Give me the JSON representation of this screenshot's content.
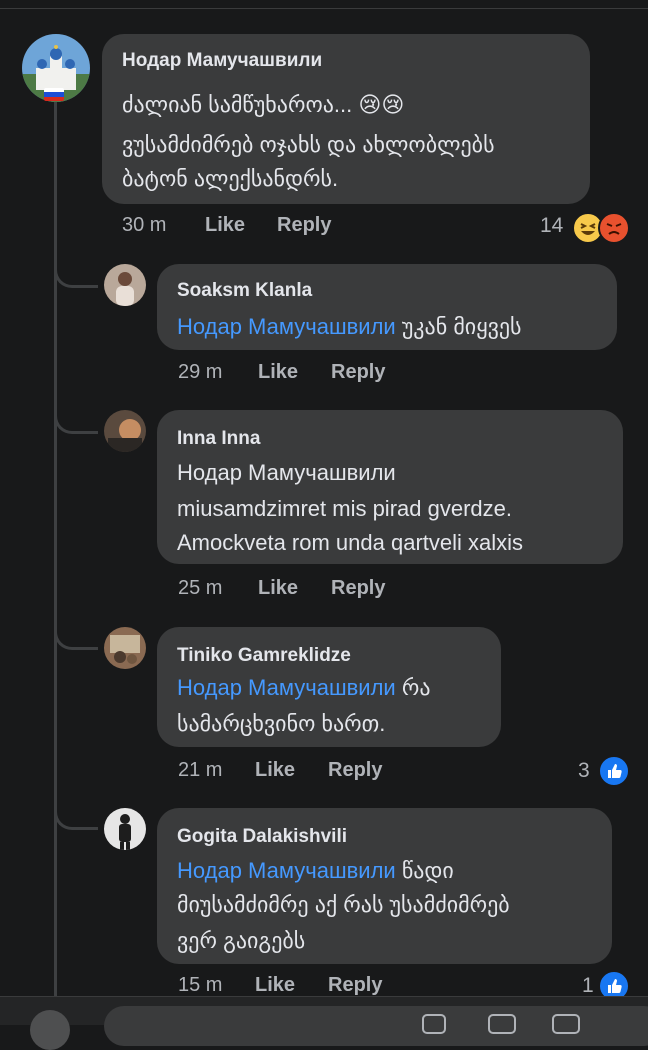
{
  "comments": [
    {
      "name": "Нодар Мамучашвили",
      "mention": "",
      "lines": [
        "ძალიან სამწუხაროა... 😢😢",
        "ვუსამძიმრებ ოჯახს და ახლობლებს",
        "ბატონ ალექსანდრს."
      ],
      "time": "30 m",
      "like": "Like",
      "reply": "Reply",
      "reaction_count": "14",
      "reactions": [
        "laughing-emoji",
        "angry-emoji"
      ]
    },
    {
      "name": "Soaksm Klanla",
      "mention": "Нодар Мамучашвили",
      "lines": [
        " უკან მიყვეს"
      ],
      "time": "29 m",
      "like": "Like",
      "reply": "Reply"
    },
    {
      "name": "Inna Inna",
      "mention": "",
      "lines": [
        "Нодар Мамучашвили",
        "miusamdzimret mis pirad gverdze.",
        "Amockveta rom unda qartveli  xalxis"
      ],
      "time": "25 m",
      "like": "Like",
      "reply": "Reply"
    },
    {
      "name": "Tiniko Gamreklidze",
      "mention": "Нодар Мамучашвили",
      "lines": [
        " რა",
        "სამარცხვინო ხართ."
      ],
      "time": "21 m",
      "like": "Like",
      "reply": "Reply",
      "reaction_count": "3",
      "reactions": [
        "like-thumb"
      ]
    },
    {
      "name": "Gogita Dalakishvili",
      "mention": "Нодар Мамучашвили",
      "lines": [
        " წადი",
        "მიუსამძიმრე  აქ რას უსამძიმრებ",
        "ვერ გაიგებს"
      ],
      "time": "15 m",
      "like": "Like",
      "reply": "Reply",
      "reaction_count": "1",
      "reactions": [
        "like-thumb"
      ]
    }
  ],
  "colors": {
    "background": "#18191a",
    "bubble": "#3a3b3c",
    "mention": "#4599ff",
    "meta": "#b0b3b8",
    "like_blue": "#1877f2"
  }
}
